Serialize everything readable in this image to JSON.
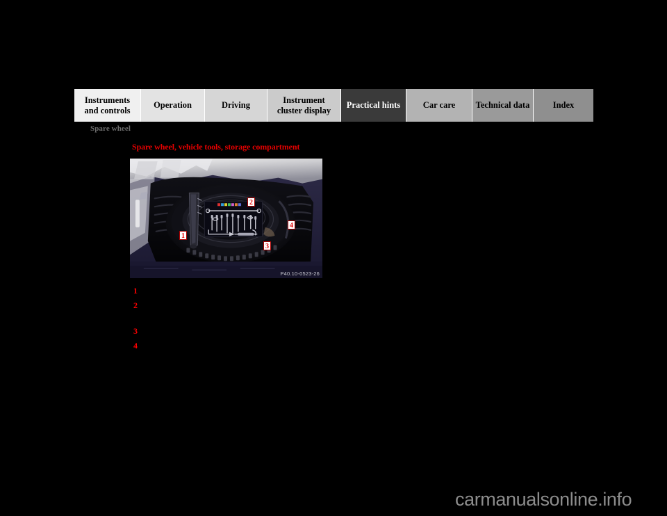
{
  "page": {
    "background_color": "#000000",
    "section_header": "Spare wheel",
    "figure_heading": "Spare wheel, vehicle tools, storage compartment",
    "accent_red": "#e60000",
    "heading_gray": "#6e6e6e"
  },
  "navbar": {
    "tabs": [
      {
        "label": "Instruments and controls",
        "active": false,
        "bg": "#f0f0f0"
      },
      {
        "label": "Operation",
        "active": false,
        "bg": "#e3e3e3"
      },
      {
        "label": "Driving",
        "active": false,
        "bg": "#d6d6d6"
      },
      {
        "label": "Instrument cluster display",
        "active": false,
        "bg": "#cbcbcb"
      },
      {
        "label": "Practical hints",
        "active": true,
        "bg": "#3a3a3a"
      },
      {
        "label": "Car care",
        "active": false,
        "bg": "#b3b3b3"
      },
      {
        "label": "Technical data",
        "active": false,
        "bg": "#9a9a9a"
      },
      {
        "label": "Index",
        "active": false,
        "bg": "#8f8f8f"
      }
    ]
  },
  "figure": {
    "code": "P40.10-0523-26",
    "alt": "Open trunk storage well showing spare wheel, vehicle tool kit and jack",
    "callouts": [
      {
        "number": "1"
      },
      {
        "number": "2"
      },
      {
        "number": "3"
      },
      {
        "number": "4"
      }
    ]
  },
  "legend": {
    "items": [
      {
        "number": "1",
        "text": ""
      },
      {
        "number": "2",
        "text": ""
      },
      {
        "number": "3",
        "text": ""
      },
      {
        "number": "4",
        "text": ""
      }
    ]
  },
  "watermark": {
    "text": "carmanualsonline.info"
  }
}
